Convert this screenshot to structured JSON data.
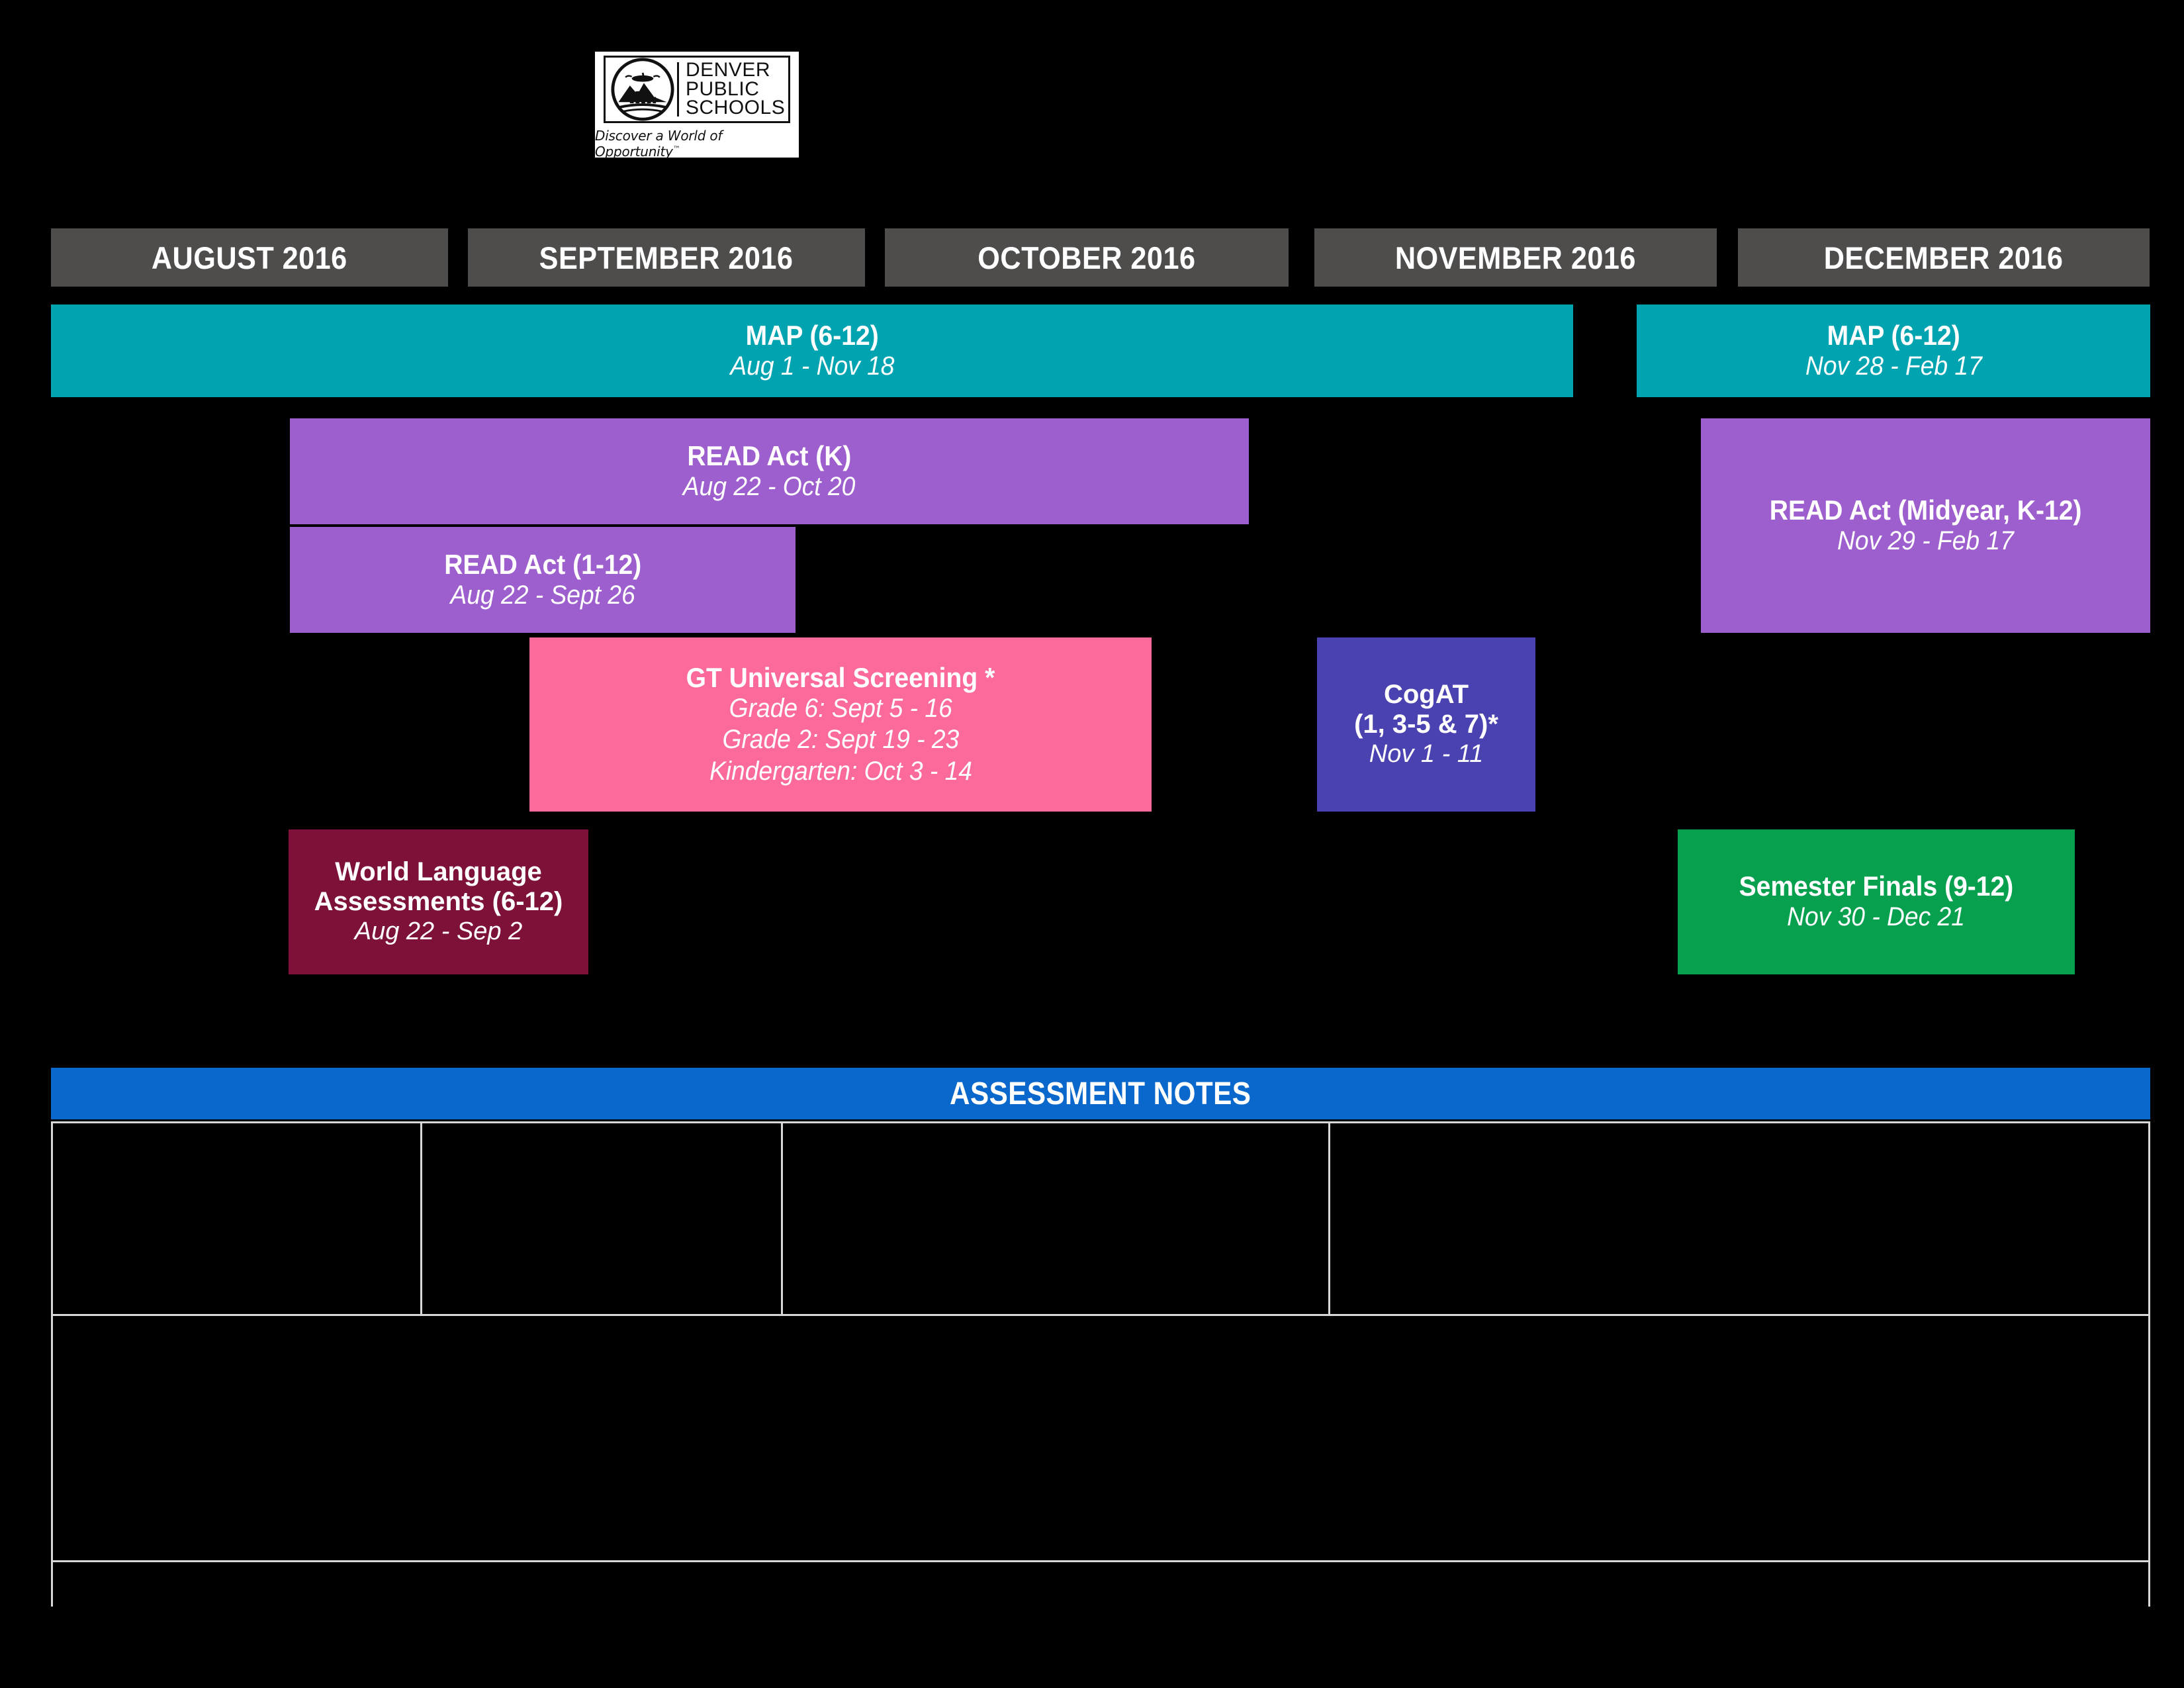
{
  "logo": {
    "name": "Denver Public Schools",
    "line1": "DENVER",
    "line2": "PUBLIC",
    "line3": "SCHOOLS",
    "tagline": "Discover a World of Opportunity",
    "trademark": "™",
    "emblem_icon": "lamp-of-learning-mountains-skyline-emblem"
  },
  "colors": {
    "background": "#000000",
    "month_header": "#4f4c4c",
    "teal": "#00a3b0",
    "purple": "#9e5fce",
    "pink": "#fb6a9b",
    "indigo": "#4a42b0",
    "maroon": "#7d1139",
    "green": "#07a04f",
    "notes_blue": "#0a68cc",
    "border": "#d8d8d8",
    "text": "#ffffff"
  },
  "months": [
    {
      "label": "AUGUST 2016"
    },
    {
      "label": "SEPTEMBER 2016"
    },
    {
      "label": "OCTOBER 2016"
    },
    {
      "label": "NOVEMBER 2016"
    },
    {
      "label": "DECEMBER 2016"
    }
  ],
  "assessments": [
    {
      "id": "map-fall",
      "title": "MAP (6-12)",
      "dates": "Aug 1 - Nov 18",
      "color": "#00a3b0"
    },
    {
      "id": "map-winter",
      "title": "MAP (6-12)",
      "dates": "Nov 28 - Feb 17",
      "color": "#00a3b0"
    },
    {
      "id": "read-act-k",
      "title": "READ Act (K)",
      "dates": "Aug 22 - Oct 20",
      "color": "#9e5fce"
    },
    {
      "id": "read-act-1-12",
      "title": "READ Act (1-12)",
      "dates": "Aug 22 - Sept 26",
      "color": "#9e5fce"
    },
    {
      "id": "read-act-midyear",
      "title": "READ Act (Midyear, K-12)",
      "dates": "Nov 29 - Feb 17",
      "color": "#9e5fce"
    },
    {
      "id": "gt-universal-screening",
      "title": "GT Universal Screening *",
      "line1": "Grade 6: Sept 5 - 16",
      "line2": "Grade 2: Sept 19 - 23",
      "line3": "Kindergarten: Oct 3 - 14",
      "color": "#fb6a9b"
    },
    {
      "id": "cogat",
      "title": "CogAT",
      "subtitle": "(1, 3-5 & 7)*",
      "dates": "Nov 1 - 11",
      "color": "#4a42b0"
    },
    {
      "id": "world-language",
      "title_line1": "World Language",
      "title_line2": "Assessments (6-12)",
      "dates": "Aug 22 - Sep 2",
      "color": "#7d1139"
    },
    {
      "id": "semester-finals",
      "title": "Semester Finals (9-12)",
      "dates": "Nov 30 - Dec 21",
      "color": "#07a04f"
    }
  ],
  "notes": {
    "header": "ASSESSMENT NOTES",
    "rows": [
      {
        "cells": [
          "",
          "",
          "",
          ""
        ]
      },
      {
        "cells": [
          ""
        ]
      },
      {
        "cells": [
          ""
        ]
      }
    ]
  }
}
